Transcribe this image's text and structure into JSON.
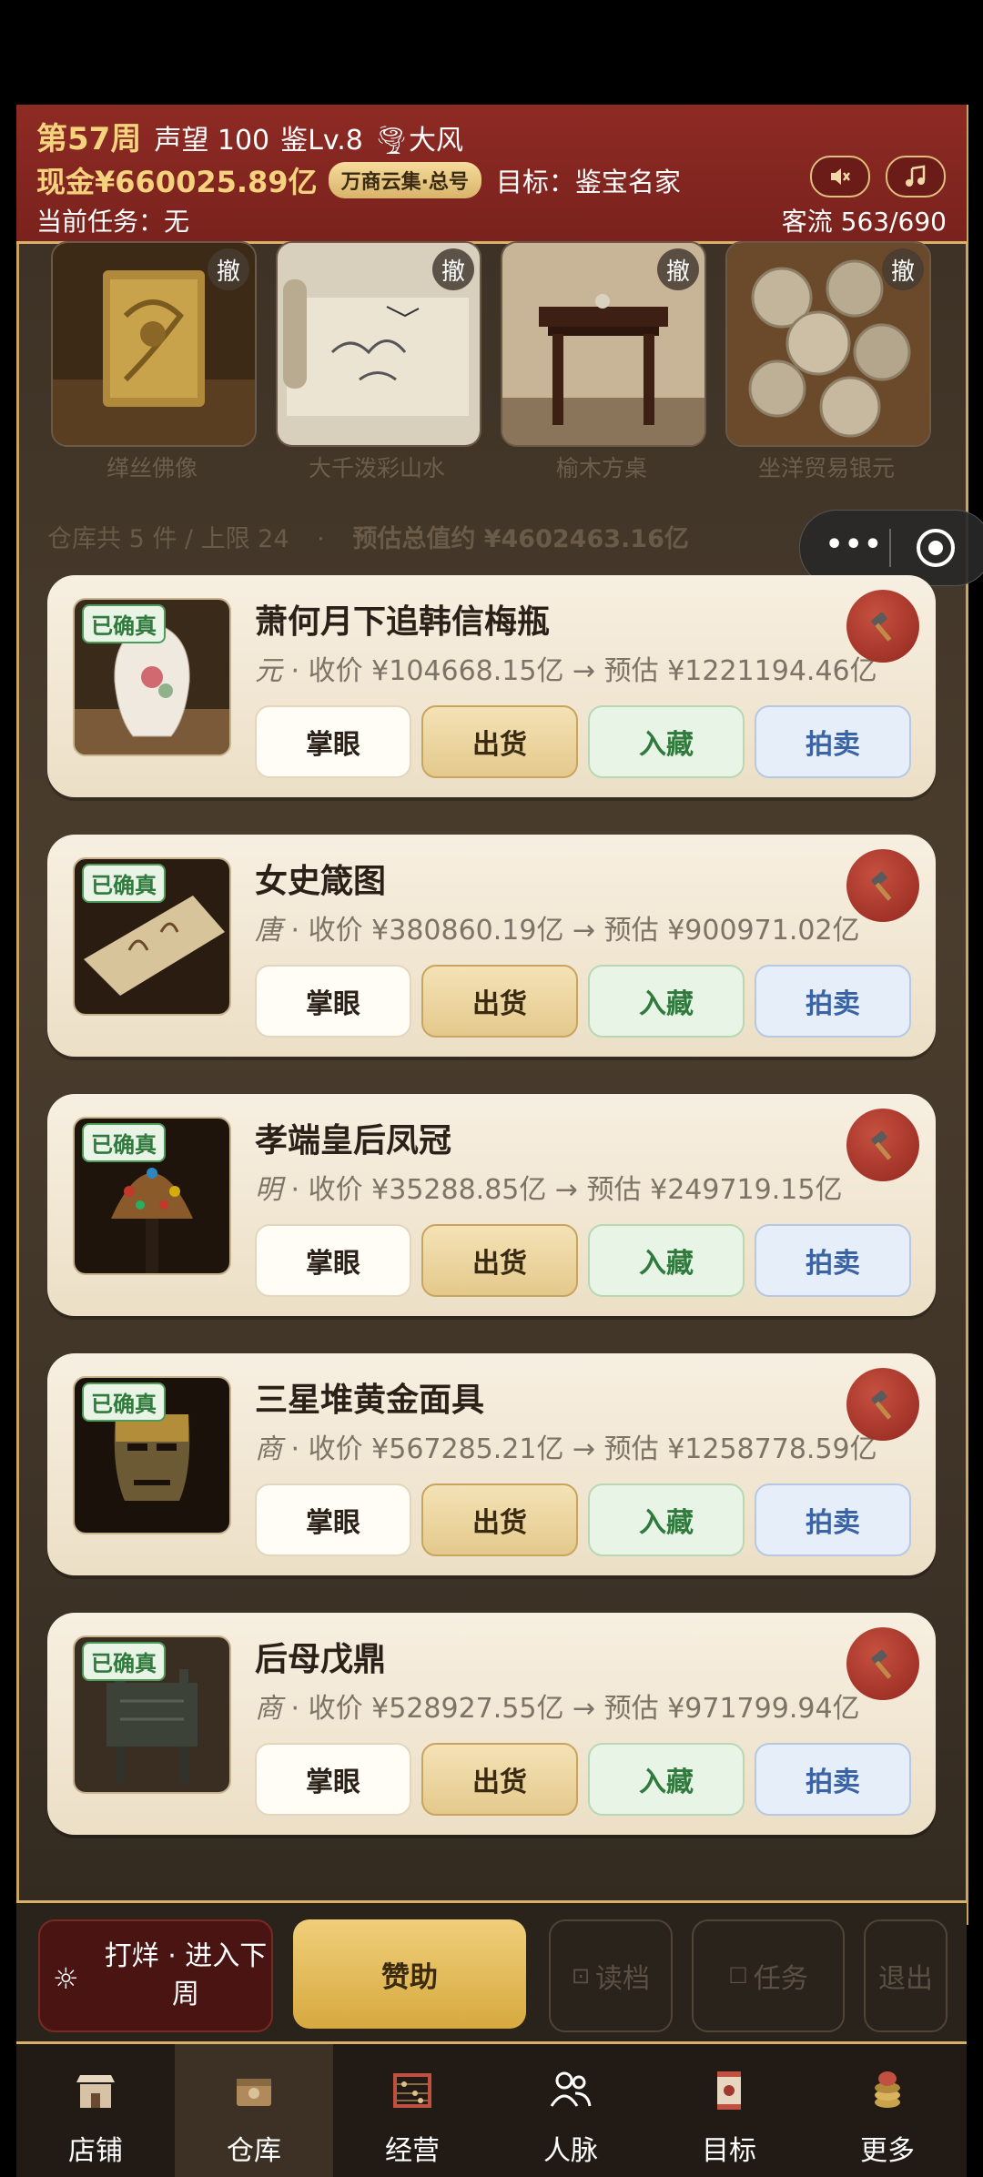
{
  "header": {
    "week": "第57周",
    "reputation": "声望 100",
    "appraise_level": "鉴Lv.8",
    "weather": "🌪大风",
    "cash": "现金¥660025.89亿",
    "badge": "万商云集·总号",
    "goal": "目标：鉴宝名家",
    "task": "当前任务：无",
    "customer_flow": "客流 563/690",
    "mute_icon": "speaker-muted-icon",
    "music_icon": "music-note-icon"
  },
  "shelf": [
    {
      "name": "缂丝佛像",
      "undo": "撤"
    },
    {
      "name": "大千泼彩山水",
      "undo": "撤"
    },
    {
      "name": "榆木方桌",
      "undo": "撤"
    },
    {
      "name": "坐洋贸易银元",
      "undo": "撤"
    }
  ],
  "summary": {
    "count": "仓库共 5 件 / 上限 24",
    "separator": "·",
    "total": "预估总值约 ¥4602463.16亿"
  },
  "miniprogram": {
    "more": "•••"
  },
  "items": [
    {
      "tag": "已确真",
      "title": "萧何月下追韩信梅瓶",
      "dynasty": "元",
      "meta": " · 收价 ¥104668.15亿 → 预估 ¥1221194.46亿",
      "b1": "掌眼",
      "b2": "出货",
      "b3": "入藏",
      "b4": "拍卖"
    },
    {
      "tag": "已确真",
      "title": "女史箴图",
      "dynasty": "唐",
      "meta": " · 收价 ¥380860.19亿 → 预估 ¥900971.02亿",
      "b1": "掌眼",
      "b2": "出货",
      "b3": "入藏",
      "b4": "拍卖"
    },
    {
      "tag": "已确真",
      "title": "孝端皇后凤冠",
      "dynasty": "明",
      "meta": " · 收价 ¥35288.85亿 → 预估 ¥249719.15亿",
      "b1": "掌眼",
      "b2": "出货",
      "b3": "入藏",
      "b4": "拍卖"
    },
    {
      "tag": "已确真",
      "title": "三星堆黄金面具",
      "dynasty": "商",
      "meta": " · 收价 ¥567285.21亿 → 预估 ¥1258778.59亿",
      "b1": "掌眼",
      "b2": "出货",
      "b3": "入藏",
      "b4": "拍卖"
    },
    {
      "tag": "已确真",
      "title": "后母戊鼎",
      "dynasty": "商",
      "meta": " · 收价 ¥528927.55亿 → 预估 ¥971799.94亿",
      "b1": "掌眼",
      "b2": "出货",
      "b3": "入藏",
      "b4": "拍卖"
    }
  ],
  "actions": {
    "close": "打烊 · 进入下周",
    "sponsor": "赞助",
    "load": "读档",
    "tasks": "任务",
    "exit": "退出"
  },
  "tabs": [
    {
      "label": "店铺",
      "icon": "shop-icon"
    },
    {
      "label": "仓库",
      "icon": "warehouse-box-icon"
    },
    {
      "label": "经营",
      "icon": "abacus-icon"
    },
    {
      "label": "人脉",
      "icon": "people-icon"
    },
    {
      "label": "目标",
      "icon": "scroll-target-icon"
    },
    {
      "label": "更多",
      "icon": "coin-stack-icon"
    }
  ],
  "colors": {
    "header_red": "#8e2a24",
    "gold": "#d9b06a",
    "card": "#f3e9d7",
    "active_tab": "#3d3125"
  }
}
